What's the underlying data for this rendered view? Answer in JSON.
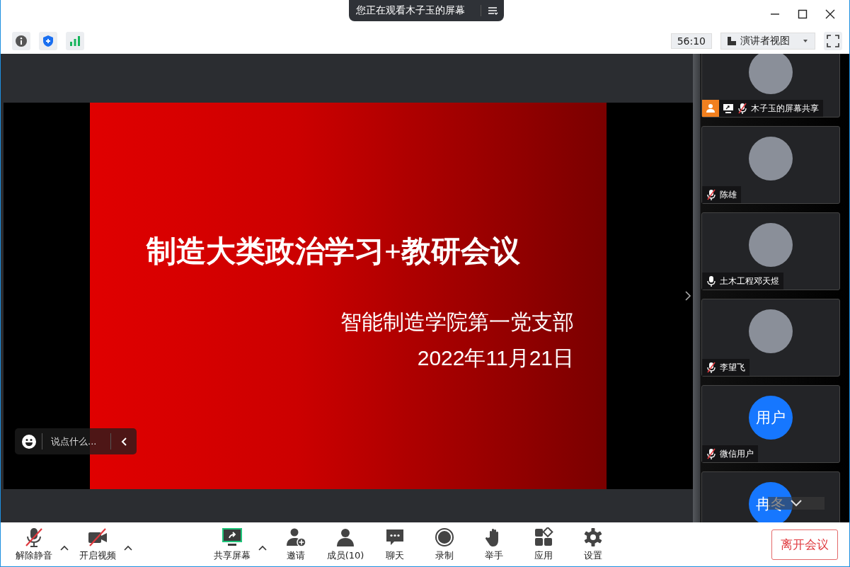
{
  "banner": {
    "text": "您正在观看木子玉的屏幕"
  },
  "toolbar": {
    "timer": "56:10",
    "view_label": "演讲者视图"
  },
  "slide": {
    "title": "制造大类政治学习+教研会议",
    "subtitle": "智能制造学院第一党支部",
    "date": "2022年11月21日"
  },
  "chat_input": {
    "placeholder": "说点什么..."
  },
  "participants": [
    {
      "name": "木子玉的屏幕共享",
      "host": true,
      "sharing": true,
      "muted": true,
      "avatar": {
        "kind": "image"
      }
    },
    {
      "name": "陈雄",
      "host": false,
      "sharing": false,
      "muted": true,
      "avatar": {
        "kind": "image"
      }
    },
    {
      "name": "土木工程邓天煜",
      "host": false,
      "sharing": false,
      "muted": false,
      "avatar": {
        "kind": "image"
      }
    },
    {
      "name": "李望飞",
      "host": false,
      "sharing": false,
      "muted": true,
      "avatar": {
        "kind": "image"
      }
    },
    {
      "name": "微信用户",
      "host": false,
      "sharing": false,
      "muted": true,
      "avatar": {
        "kind": "text",
        "text": "用户"
      }
    },
    {
      "avatar": {
        "kind": "text",
        "text": "冉冬"
      }
    }
  ],
  "controls": [
    {
      "kind": "mic",
      "label": "解除静音",
      "off": true,
      "menu": true
    },
    {
      "kind": "video",
      "label": "开启视频",
      "off": true,
      "menu": true
    },
    {
      "kind": "share",
      "label": "共享屏幕",
      "off": false,
      "menu": true
    },
    {
      "kind": "invite",
      "label": "邀请",
      "off": false,
      "menu": false
    },
    {
      "kind": "members",
      "label": "成员(10)",
      "off": false,
      "menu": false
    },
    {
      "kind": "chat",
      "label": "聊天",
      "off": false,
      "menu": false
    },
    {
      "kind": "record",
      "label": "录制",
      "off": false,
      "menu": false
    },
    {
      "kind": "hand",
      "label": "举手",
      "off": false,
      "menu": false
    },
    {
      "kind": "apps",
      "label": "应用",
      "off": false,
      "menu": false
    },
    {
      "kind": "settings",
      "label": "设置",
      "off": false,
      "menu": false
    }
  ],
  "leave_button": "离开会议"
}
